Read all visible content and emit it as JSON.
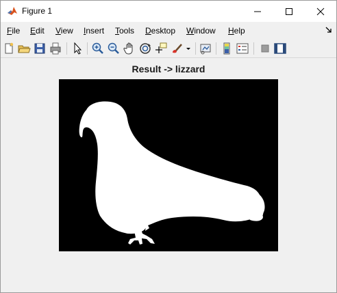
{
  "window": {
    "title": "Figure 1"
  },
  "menu": {
    "items": [
      {
        "first": "F",
        "rest": "ile"
      },
      {
        "first": "E",
        "rest": "dit"
      },
      {
        "first": "V",
        "rest": "iew"
      },
      {
        "first": "I",
        "rest": "nsert"
      },
      {
        "first": "T",
        "rest": "ools"
      },
      {
        "first": "D",
        "rest": "esktop"
      },
      {
        "first": "W",
        "rest": "indow"
      },
      {
        "first": "H",
        "rest": "elp"
      }
    ]
  },
  "toolbar": {
    "icons": [
      "new-figure-icon",
      "open-file-icon",
      "save-icon",
      "print-icon",
      "pointer-icon",
      "zoom-in-icon",
      "zoom-out-icon",
      "pan-icon",
      "rotate-3d-icon",
      "data-cursor-icon",
      "brush-icon",
      "link-plot-icon",
      "insert-colorbar-icon",
      "insert-legend-icon",
      "hide-plot-tools-icon",
      "show-plot-tools-icon"
    ]
  },
  "figure": {
    "title": "Result -> lizzard",
    "background": "#000000",
    "silhouette_color": "#ffffff"
  }
}
